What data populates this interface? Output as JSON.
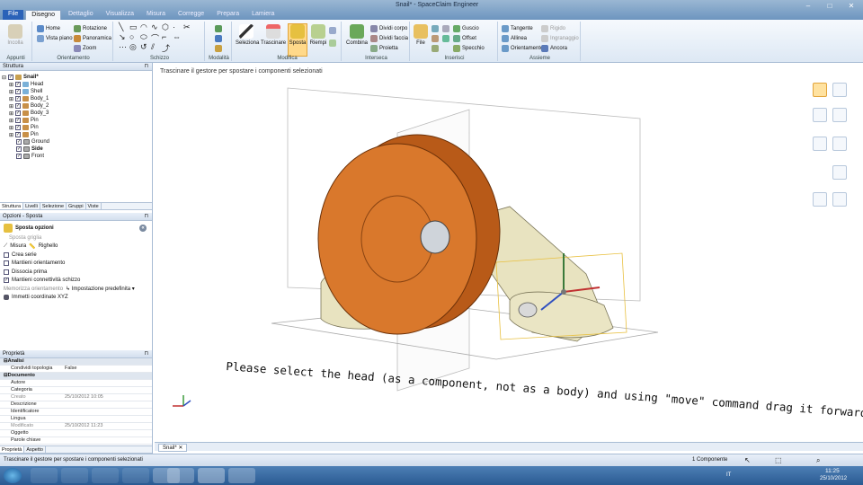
{
  "window": {
    "title": "Snail* - SpaceClaim Engineer",
    "controls": [
      "–",
      "□",
      "✕"
    ]
  },
  "ribbon_tabs": [
    {
      "label": "File"
    },
    {
      "label": "Disegno"
    },
    {
      "label": "Dettaglio"
    },
    {
      "label": "Visualizza"
    },
    {
      "label": "Misura"
    },
    {
      "label": "Corregge"
    },
    {
      "label": "Prepara"
    },
    {
      "label": "Lamiera"
    }
  ],
  "ribbon": {
    "appunti": {
      "label": "Appunti",
      "incolla": "Incolla"
    },
    "orientamento": {
      "label": "Orientamento",
      "items": [
        "Home",
        "Vista piano",
        "Rotazione",
        "Panoramica",
        "Zoom"
      ]
    },
    "schizzo": {
      "label": "Schizzo"
    },
    "modalita": {
      "label": "Modalità"
    },
    "modifica": {
      "label": "Modifica",
      "seleziona": "Seleziona",
      "trascinare": "Trascinare",
      "sposta": "Sposta",
      "riempi": "Riempi"
    },
    "interseca": {
      "label": "Interseca",
      "combina": "Combina",
      "dividi_corpo": "Dividi corpo",
      "dividi_faccia": "Dividi faccia",
      "proietta": "Proietta"
    },
    "inserisci": {
      "label": "Inserisci",
      "file": "File",
      "guscio": "Guscio",
      "offset": "Offset",
      "specchio": "Specchio"
    },
    "assieme": {
      "label": "Assieme",
      "tangente": "Tangente",
      "allinea": "Allinea",
      "orientamento": "Orientamento",
      "rigido": "Rigido",
      "ingranaggio": "Ingranaggio",
      "ancora": "Ancora"
    }
  },
  "structure": {
    "title": "Struttura",
    "items": [
      {
        "label": "Snail*"
      },
      {
        "label": "Head"
      },
      {
        "label": "Shell"
      },
      {
        "label": "Body_1"
      },
      {
        "label": "Body_2"
      },
      {
        "label": "Body_3"
      },
      {
        "label": "Pin"
      },
      {
        "label": "Pin"
      },
      {
        "label": "Pin"
      },
      {
        "label": "Ground"
      },
      {
        "label": "Side"
      },
      {
        "label": "Front"
      }
    ],
    "tabs": [
      "Struttura",
      "Livelli",
      "Selezione",
      "Gruppi",
      "Viste"
    ]
  },
  "options": {
    "title": "Opzioni - Sposta",
    "header": "Sposta opzioni",
    "sposta_griglia": "Sposta griglia",
    "misura": "Misura",
    "righello": "Righello",
    "checks": [
      {
        "label": "Crea serie",
        "checked": false
      },
      {
        "label": "Mantieni orientamento",
        "checked": false
      },
      {
        "label": "Dissocia prima",
        "checked": false
      },
      {
        "label": "Mantieni connettività schizzo",
        "checked": true
      }
    ],
    "memorizza_label": "Memorizza orientamento",
    "memorizza_value": "Impostazione predefinita",
    "immetti": "Immetti coordinate XYZ"
  },
  "properties": {
    "title": "Proprietà",
    "sections": [
      {
        "name": "Analisi",
        "rows": [
          {
            "k": "Condividi topologia",
            "v": "False"
          }
        ]
      },
      {
        "name": "Documento",
        "rows": [
          {
            "k": "Autore",
            "v": ""
          },
          {
            "k": "Categoria",
            "v": ""
          },
          {
            "k": "Creato",
            "v": "25/10/2012 10:05"
          },
          {
            "k": "Descrizione",
            "v": ""
          },
          {
            "k": "Identificatore",
            "v": ""
          },
          {
            "k": "Lingua",
            "v": ""
          },
          {
            "k": "Modificato",
            "v": "25/10/2012 11:23"
          },
          {
            "k": "Oggetto",
            "v": ""
          },
          {
            "k": "Parole chiave",
            "v": ""
          }
        ]
      }
    ],
    "tabs": [
      "Proprietà",
      "Aspetto"
    ]
  },
  "viewport": {
    "hint": "Trascinare il gestore per spostare i componenti selezionati",
    "doc_tab": "Snail*",
    "annotation": "Please select the head (as a component, not as a body) and using \"move\" command drag it forward ..."
  },
  "status": {
    "message": "Trascinare il gestore per spostare i componenti selezionati",
    "selection": "1 Componente"
  },
  "taskbar": {
    "lang": "IT",
    "time": "11:25",
    "date": "25/10/2012"
  },
  "colors": {
    "accent": "#2a62b8",
    "model_orange": "#c8641c",
    "model_cream": "#e8e3c0"
  }
}
